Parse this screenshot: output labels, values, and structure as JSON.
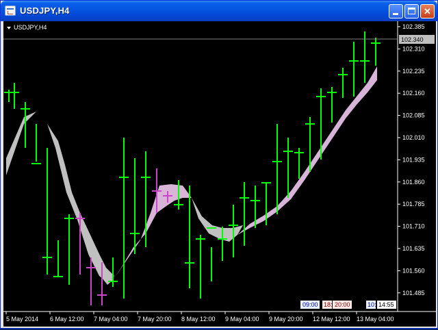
{
  "window": {
    "title": "USDJPY,H4"
  },
  "chart": {
    "symbol_label": "USDJPY,H4",
    "current_price": "102.340",
    "y_ticks": [
      "102.385",
      "102.310",
      "102.235",
      "102.160",
      "102.085",
      "102.010",
      "101.935",
      "101.860",
      "101.785",
      "101.710",
      "101.635",
      "101.560",
      "101.485"
    ],
    "x_ticks": [
      "5 May 2014",
      "6 May 12:00",
      "7 May 04:00",
      "7 May 20:00",
      "8 May 12:00",
      "9 May 04:00",
      "9 May 20:00",
      "12 May 12:00",
      "13 May 04:00"
    ],
    "session_markers": [
      "09:00",
      "18:",
      "20:00",
      "10:",
      "14:55"
    ],
    "colors": {
      "background": "#000000",
      "bar": "#00ff00",
      "bar_alt": "#cc44cc",
      "band_up": "#d8b4d8",
      "band_down": "#c0c0c0",
      "axis": "#ffffff"
    }
  }
}
